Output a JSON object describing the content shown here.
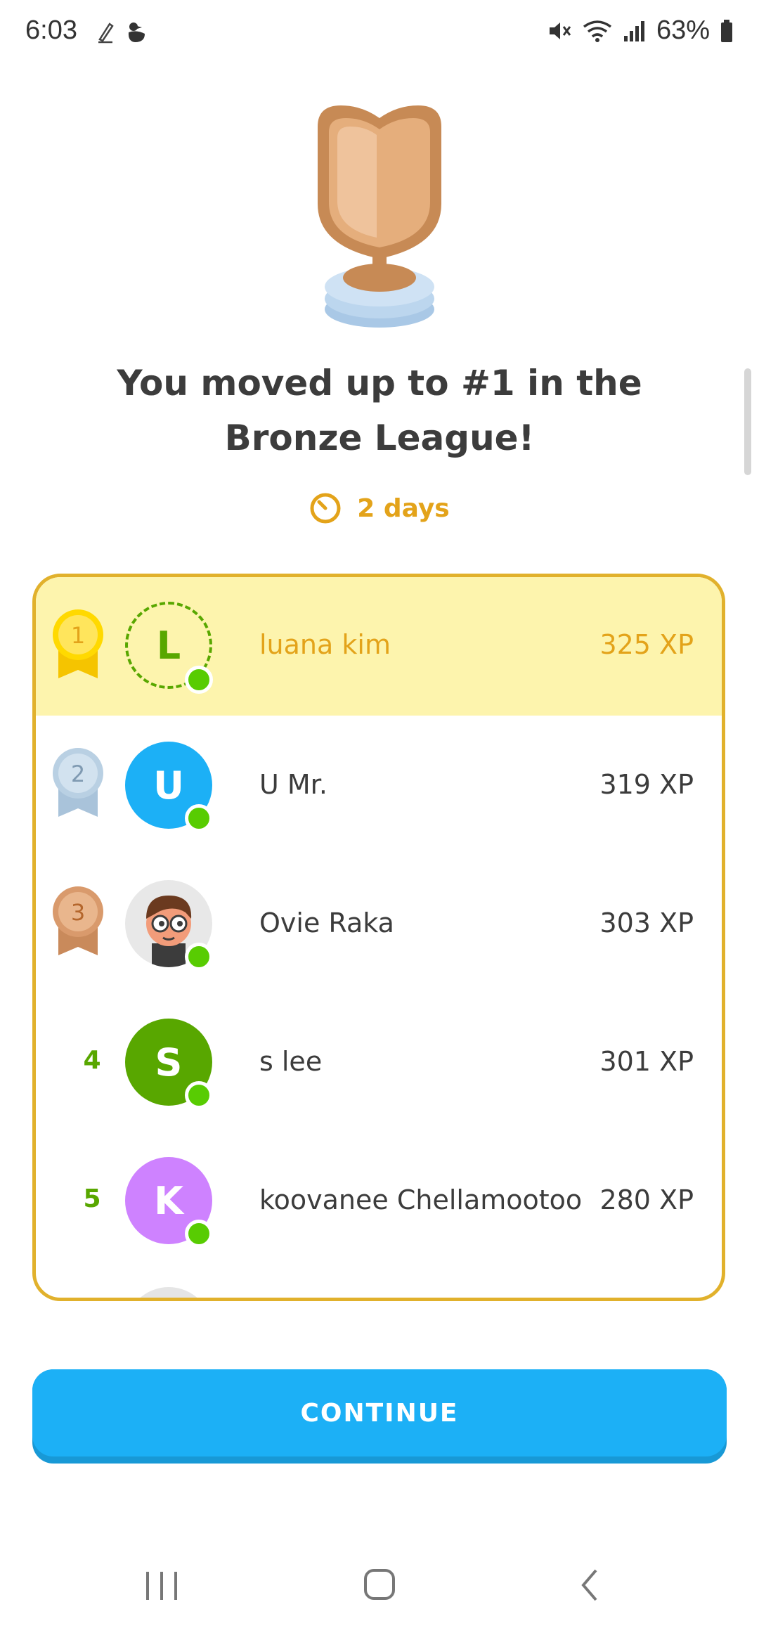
{
  "status_bar": {
    "time": "6:03",
    "battery": "63%",
    "icons": [
      "pen-icon",
      "duck-icon",
      "mute-icon",
      "wifi-icon",
      "signal-icon",
      "battery-icon"
    ]
  },
  "promotion": {
    "headline": "You moved up to #1 in the Bronze League!",
    "timer": "2 days",
    "trophy_icon": "bronze-trophy-icon"
  },
  "leaderboard": {
    "rows": [
      {
        "rank": "1",
        "name": "luana kim",
        "xp": "325 XP",
        "avatar_letter": "L",
        "avatar_color": "#ffffff",
        "highlight": true
      },
      {
        "rank": "2",
        "name": "U Mr.",
        "xp": "319 XP",
        "avatar_letter": "U",
        "avatar_color": "#1cb0f6"
      },
      {
        "rank": "3",
        "name": "Ovie Raka",
        "xp": "303 XP",
        "avatar_letter": "",
        "avatar_color": "#e8e8e8"
      },
      {
        "rank": "4",
        "name": "s lee",
        "xp": "301 XP",
        "avatar_letter": "S",
        "avatar_color": "#58a700"
      },
      {
        "rank": "5",
        "name": "koovanee Chellamootoo",
        "xp": "280 XP",
        "avatar_letter": "K",
        "avatar_color": "#ce82ff"
      }
    ]
  },
  "continue_button": {
    "label": "CONTINUE"
  },
  "nav_bar": {
    "icons": [
      "recent-apps-icon",
      "home-icon",
      "back-icon"
    ]
  },
  "colors": {
    "accent_blue": "#1cb0f6",
    "gold": "#e3a31a",
    "highlight_bg": "#fdf4ad",
    "online_green": "#58cc02"
  }
}
